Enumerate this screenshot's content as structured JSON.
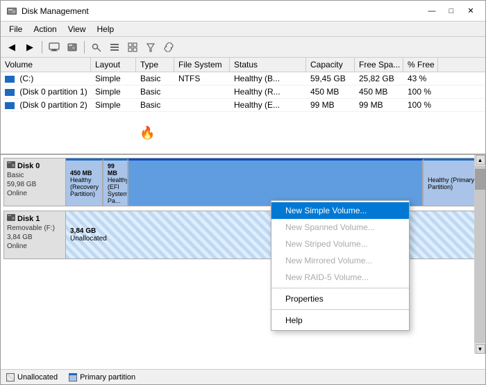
{
  "window": {
    "title": "Disk Management",
    "controls": {
      "minimize": "—",
      "maximize": "□",
      "close": "✕"
    }
  },
  "menu": {
    "items": [
      "File",
      "Action",
      "View",
      "Help"
    ]
  },
  "toolbar": {
    "buttons": [
      "◀",
      "▶",
      "🖥",
      "⚙",
      "🔒",
      "📋",
      "📌",
      "📎"
    ]
  },
  "volume_list": {
    "headers": [
      "Volume",
      "Layout",
      "Type",
      "File System",
      "Status",
      "Capacity",
      "Free Spa...",
      "% Free"
    ],
    "rows": [
      {
        "volume": "(C:)",
        "layout": "Simple",
        "type": "Basic",
        "filesystem": "NTFS",
        "status": "Healthy (B...",
        "capacity": "59,45 GB",
        "free": "25,82 GB",
        "pct": "43 %"
      },
      {
        "volume": "(Disk 0 partition 1)",
        "layout": "Simple",
        "type": "Basic",
        "filesystem": "",
        "status": "Healthy (R...",
        "capacity": "450 MB",
        "free": "450 MB",
        "pct": "100 %"
      },
      {
        "volume": "(Disk 0 partition 2)",
        "layout": "Simple",
        "type": "Basic",
        "filesystem": "",
        "status": "Healthy (E...",
        "capacity": "99 MB",
        "free": "99 MB",
        "pct": "100 %"
      }
    ]
  },
  "disk_view": {
    "disks": [
      {
        "name": "Disk 0",
        "type": "Basic",
        "size": "59,98 GB",
        "status": "Online",
        "partitions": [
          {
            "label": "450 MB\nHealthy (Recovery Partition)",
            "type": "recovery",
            "width": 8
          },
          {
            "label": "99 MB\nHealthy (EFI System Pa...",
            "type": "efi",
            "width": 6
          },
          {
            "label": "",
            "type": "selected",
            "width": 72
          },
          {
            "label": "Healthy (Primary Partition)",
            "type": "primary",
            "width": 14
          }
        ]
      },
      {
        "name": "Disk 1",
        "type": "Removable (F:)",
        "size": "3,84 GB",
        "status": "Online",
        "partitions": [
          {
            "label": "3,84 GB\nUnallocated",
            "type": "unallocated-disk1",
            "width": 100
          }
        ]
      }
    ]
  },
  "context_menu": {
    "items": [
      {
        "label": "New Simple Volume...",
        "type": "highlighted"
      },
      {
        "label": "New Spanned Volume...",
        "type": "disabled"
      },
      {
        "label": "New Striped Volume...",
        "type": "disabled"
      },
      {
        "label": "New Mirrored Volume...",
        "type": "disabled"
      },
      {
        "label": "New RAID-5 Volume...",
        "type": "disabled"
      },
      {
        "type": "separator"
      },
      {
        "label": "Properties",
        "type": "normal"
      },
      {
        "type": "separator"
      },
      {
        "label": "Help",
        "type": "normal"
      }
    ]
  },
  "legend": {
    "items": [
      {
        "label": "Unallocated",
        "style": "unalloc"
      },
      {
        "label": "Primary partition",
        "style": "primary-p"
      }
    ]
  }
}
